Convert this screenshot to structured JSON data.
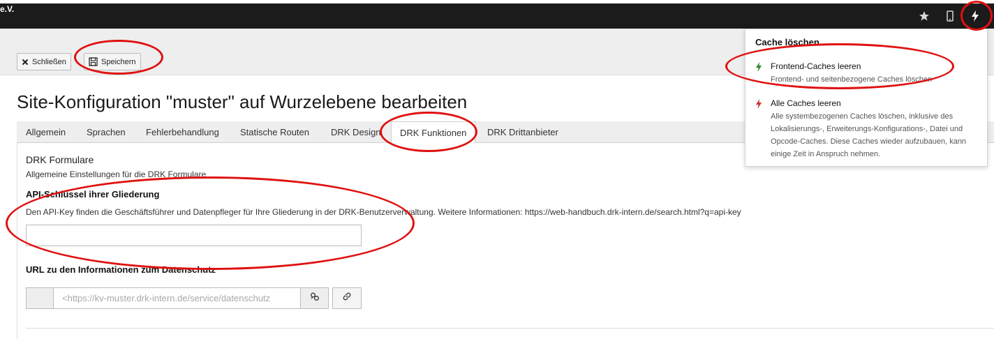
{
  "topbar": {
    "brand": "e.V.",
    "icons": [
      "star-icon",
      "mobile-icon",
      "bolt-icon"
    ]
  },
  "toolbar": {
    "close_label": "Schließen",
    "save_label": "Speichern"
  },
  "page": {
    "title": "Site-Konfiguration \"muster\" auf Wurzelebene bearbeiten"
  },
  "tabs": [
    {
      "label": "Allgemein",
      "active": false
    },
    {
      "label": "Sprachen",
      "active": false
    },
    {
      "label": "Fehlerbehandlung",
      "active": false
    },
    {
      "label": "Statische Routen",
      "active": false
    },
    {
      "label": "DRK Design",
      "active": false
    },
    {
      "label": "DRK Funktionen",
      "active": true
    },
    {
      "label": "DRK Drittanbieter",
      "active": false
    }
  ],
  "form": {
    "section_title": "DRK Formulare",
    "section_desc": "Allgemeine Einstellungen für die DRK Formulare",
    "api_label": "API-Schlüssel ihrer Gliederung",
    "api_desc": "Den API-Key finden die Geschäftsführer und Datenpfleger für Ihre Gliederung in der DRK-Benutzerverwaltung. Weitere Informationen: https://web-handbuch.drk-intern.de/search.html?q=api-key",
    "api_value": "",
    "url_label": "URL zu den Informationen zum Datenschutz",
    "url_placeholder": "<https://kv-muster.drk-intern.de/service/datenschutz"
  },
  "cache_menu": {
    "header": "Cache löschen",
    "items": [
      {
        "title": "Frontend-Caches leeren",
        "desc": "Frontend- und seitenbezogene Caches löschen",
        "color": "#2e8b2e"
      },
      {
        "title": "Alle Caches leeren",
        "desc": "Alle systembezogenen Caches löschen, inklusive des Lokalisierungs-, Erweiterungs-Konfigurations-, Datei und Opcode-Caches. Diese Caches wieder aufzubauen, kann einige Zeit in Anspruch nehmen.",
        "color": "#d03030"
      }
    ]
  },
  "colors": {
    "topbar": "#1b1b1b",
    "annotation": "#e01010"
  }
}
